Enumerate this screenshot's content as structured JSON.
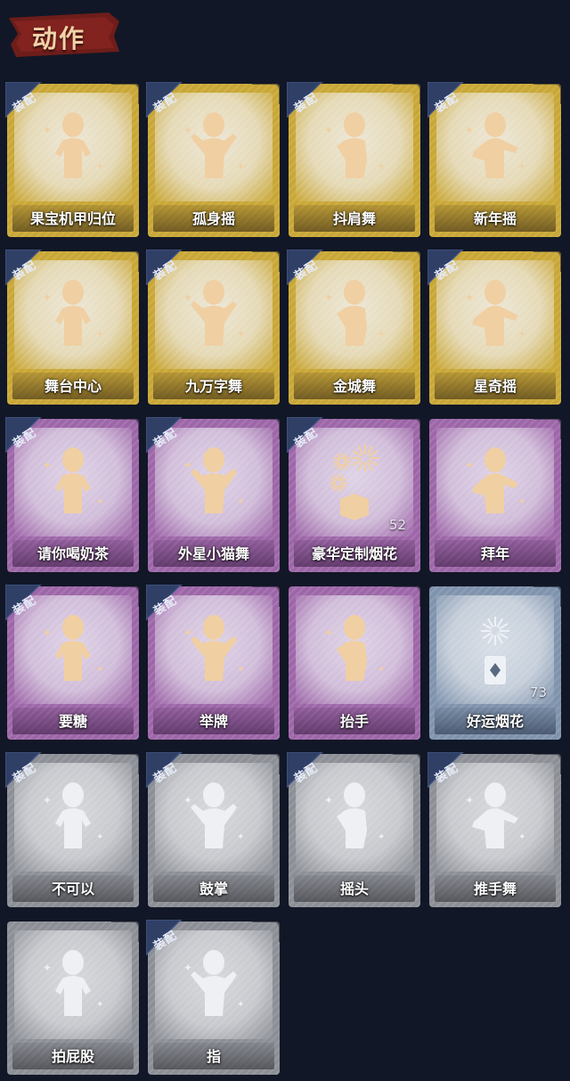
{
  "section": {
    "title": "动作",
    "title_color": "#f2d2a8",
    "banner_color": "#6e1d1a"
  },
  "equip_badge_label": "装配",
  "tiers": {
    "gold": {
      "bg": "#c9a736",
      "inner": "#ece6d6",
      "icon": "#f0cfa2"
    },
    "purple": {
      "bg": "#9d66a8",
      "inner": "#ded3e6",
      "icon": "#f0cfa2"
    },
    "blue": {
      "bg": "#7f93ad",
      "inner": "#d8dee6",
      "icon": "#eef2f6"
    },
    "grey": {
      "bg": "#8c8f96",
      "inner": "#d7d8dc",
      "icon": "#eef0f4"
    }
  },
  "emotes": [
    {
      "name": "果宝机甲归位",
      "tier": "gold",
      "equipped": true,
      "icon": "person-shrug-icon",
      "count": ""
    },
    {
      "name": "孤身摇",
      "tier": "gold",
      "equipped": true,
      "icon": "person-dance-icon",
      "count": ""
    },
    {
      "name": "抖肩舞",
      "tier": "gold",
      "equipped": true,
      "icon": "person-shoulder-icon",
      "count": ""
    },
    {
      "name": "新年摇",
      "tier": "gold",
      "equipped": true,
      "icon": "person-music-icon",
      "count": ""
    },
    {
      "name": "舞台中心",
      "tier": "gold",
      "equipped": true,
      "icon": "person-sparkle-icon",
      "count": ""
    },
    {
      "name": "九万字舞",
      "tier": "gold",
      "equipped": true,
      "icon": "person-swirl-icon",
      "count": ""
    },
    {
      "name": "金城舞",
      "tier": "gold",
      "equipped": true,
      "icon": "person-wave-icon",
      "count": ""
    },
    {
      "name": "星奇摇",
      "tier": "gold",
      "equipped": true,
      "icon": "person-pose-icon",
      "count": ""
    },
    {
      "name": "请你喝奶茶",
      "tier": "purple",
      "equipped": true,
      "icon": "person-scroll-icon",
      "count": ""
    },
    {
      "name": "外星小猫舞",
      "tier": "purple",
      "equipped": true,
      "icon": "person-cat-dance-icon",
      "count": ""
    },
    {
      "name": "豪华定制烟花",
      "tier": "purple",
      "equipped": true,
      "icon": "fireworks-box-icon",
      "count": "52"
    },
    {
      "name": "拜年",
      "tier": "purple",
      "equipped": false,
      "icon": "person-bow-icon",
      "count": ""
    },
    {
      "name": "要糖",
      "tier": "purple",
      "equipped": true,
      "icon": "person-reach-icon",
      "count": ""
    },
    {
      "name": "举牌",
      "tier": "purple",
      "equipped": true,
      "icon": "person-sign-icon",
      "count": ""
    },
    {
      "name": "抬手",
      "tier": "purple",
      "equipped": false,
      "icon": "person-raise-hand-icon",
      "count": ""
    },
    {
      "name": "好运烟花",
      "tier": "blue",
      "equipped": false,
      "icon": "firework-can-icon",
      "count": "73"
    },
    {
      "name": "不可以",
      "tier": "grey",
      "equipped": true,
      "icon": "finger-no-icon",
      "count": ""
    },
    {
      "name": "鼓掌",
      "tier": "grey",
      "equipped": true,
      "icon": "clap-hands-icon",
      "count": ""
    },
    {
      "name": "摇头",
      "tier": "grey",
      "equipped": true,
      "icon": "person-shake-head-icon",
      "count": ""
    },
    {
      "name": "推手舞",
      "tier": "grey",
      "equipped": true,
      "icon": "person-push-dance-icon",
      "count": ""
    },
    {
      "name": "拍屁股",
      "tier": "grey",
      "equipped": false,
      "icon": "person-pat-icon",
      "count": ""
    },
    {
      "name": "指",
      "tier": "grey",
      "equipped": true,
      "icon": "pointing-hand-icon",
      "count": ""
    }
  ]
}
